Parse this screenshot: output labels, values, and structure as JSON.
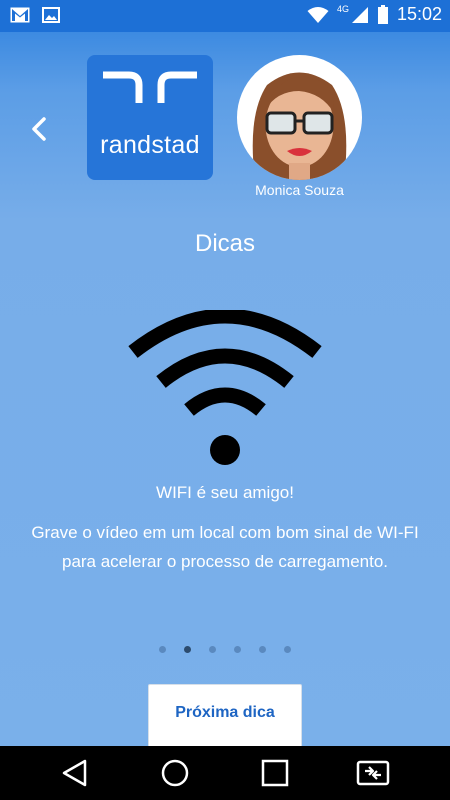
{
  "status_bar": {
    "time": "15:02",
    "network": "4G",
    "icons": [
      "gmail-icon",
      "image-icon",
      "wifi-status-icon",
      "signal-icon",
      "battery-icon"
    ]
  },
  "header": {
    "logo_text": "randstad",
    "user_name": "Monica Souza"
  },
  "main": {
    "title": "Dicas",
    "tip_icon": "wifi-icon",
    "tip_heading": "WIFI é seu amigo!",
    "tip_body": "Grave o vídeo em um local com bom sinal de WI-FI para acelerar o processo de carregamento.",
    "pager": {
      "count": 6,
      "active_index": 1
    }
  },
  "actions": {
    "next_label": "Próxima dica"
  },
  "nav_bar": {
    "icons": [
      "back-triangle-icon",
      "home-circle-icon",
      "recents-square-icon",
      "screen-cast-icon"
    ]
  },
  "colors": {
    "statusbar": "#1d70d6",
    "background": "#7ab0ea",
    "logo_bg": "#2675d8",
    "button_text": "#1e65c3"
  }
}
